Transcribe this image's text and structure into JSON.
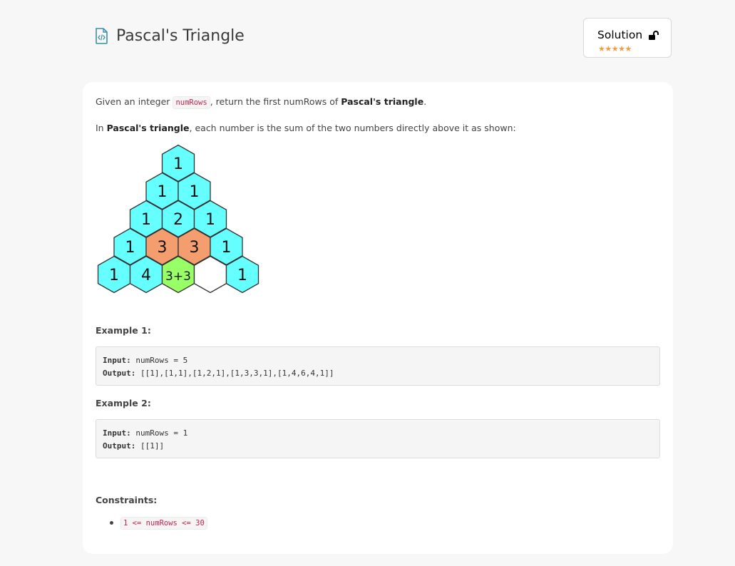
{
  "header": {
    "title": "Pascal's Triangle",
    "icon": "code-file-icon"
  },
  "solution": {
    "label": "Solution",
    "stars_text": "★★★★★",
    "rating": 4.5,
    "icon": "unlock-icon"
  },
  "description": {
    "p1_prefix": "Given an integer ",
    "p1_code": "numRows",
    "p1_mid": ", return the first numRows of ",
    "p1_bold": "Pascal's triangle",
    "p1_suffix": ".",
    "p2_prefix": "In ",
    "p2_bold": "Pascal's triangle",
    "p2_suffix": ", each number is the sum of the two numbers directly above it as shown:"
  },
  "triangle": {
    "rows": [
      [
        "1"
      ],
      [
        "1",
        "1"
      ],
      [
        "1",
        "2",
        "1"
      ],
      [
        "1",
        "3",
        "3",
        "1"
      ],
      [
        "1",
        "4",
        "3+3",
        "",
        "1"
      ]
    ],
    "colors": {
      "default": "#66ffff",
      "highlight": "#f49e70",
      "sum": "#99ff66",
      "empty": "#ffffff"
    }
  },
  "examples": [
    {
      "title": "Example 1:",
      "input_label": "Input:",
      "input_value": " numRows = 5",
      "output_label": "Output:",
      "output_value": " [[1],[1,1],[1,2,1],[1,3,3,1],[1,4,6,4,1]]"
    },
    {
      "title": "Example 2:",
      "input_label": "Input:",
      "input_value": " numRows = 1",
      "output_label": "Output:",
      "output_value": " [[1]]"
    }
  ],
  "constraints": {
    "title": "Constraints:",
    "items": [
      "1 <= numRows <= 30"
    ]
  }
}
